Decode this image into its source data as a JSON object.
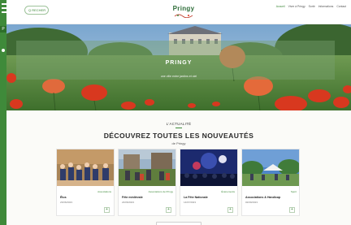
{
  "header": {
    "search_label": "Q RECHER",
    "logo_name": "Pringy",
    "nav": [
      "Accueil",
      "Vivre à Pringy",
      "Sortir",
      "Informations",
      "Contact"
    ]
  },
  "hero": {
    "title": "PRINGY",
    "subtitle": "une ville entre jardins et ciel"
  },
  "news": {
    "kicker": "L'ACTUALITÉ",
    "title": "DÉCOUVREZ TOUTES LES NOUVEAUTÉS",
    "subtitle": "de Pringy",
    "cards": [
      {
        "category": "Associations",
        "title": "Élus",
        "date": "23/06/2023"
      },
      {
        "category": "Associations de Pringy",
        "title": "Fête médiévale",
        "date": "24/06/2023"
      },
      {
        "category": "Événements",
        "title": "La Fête Nationale",
        "date": "14/07/2023"
      },
      {
        "category": "Sport",
        "title": "Associations & Handicap",
        "date": "02/09/2023"
      }
    ]
  },
  "colors": {
    "accent": "#3f8a3a",
    "hero_sky": "#8db3d3",
    "poppy": "#d8381f"
  }
}
